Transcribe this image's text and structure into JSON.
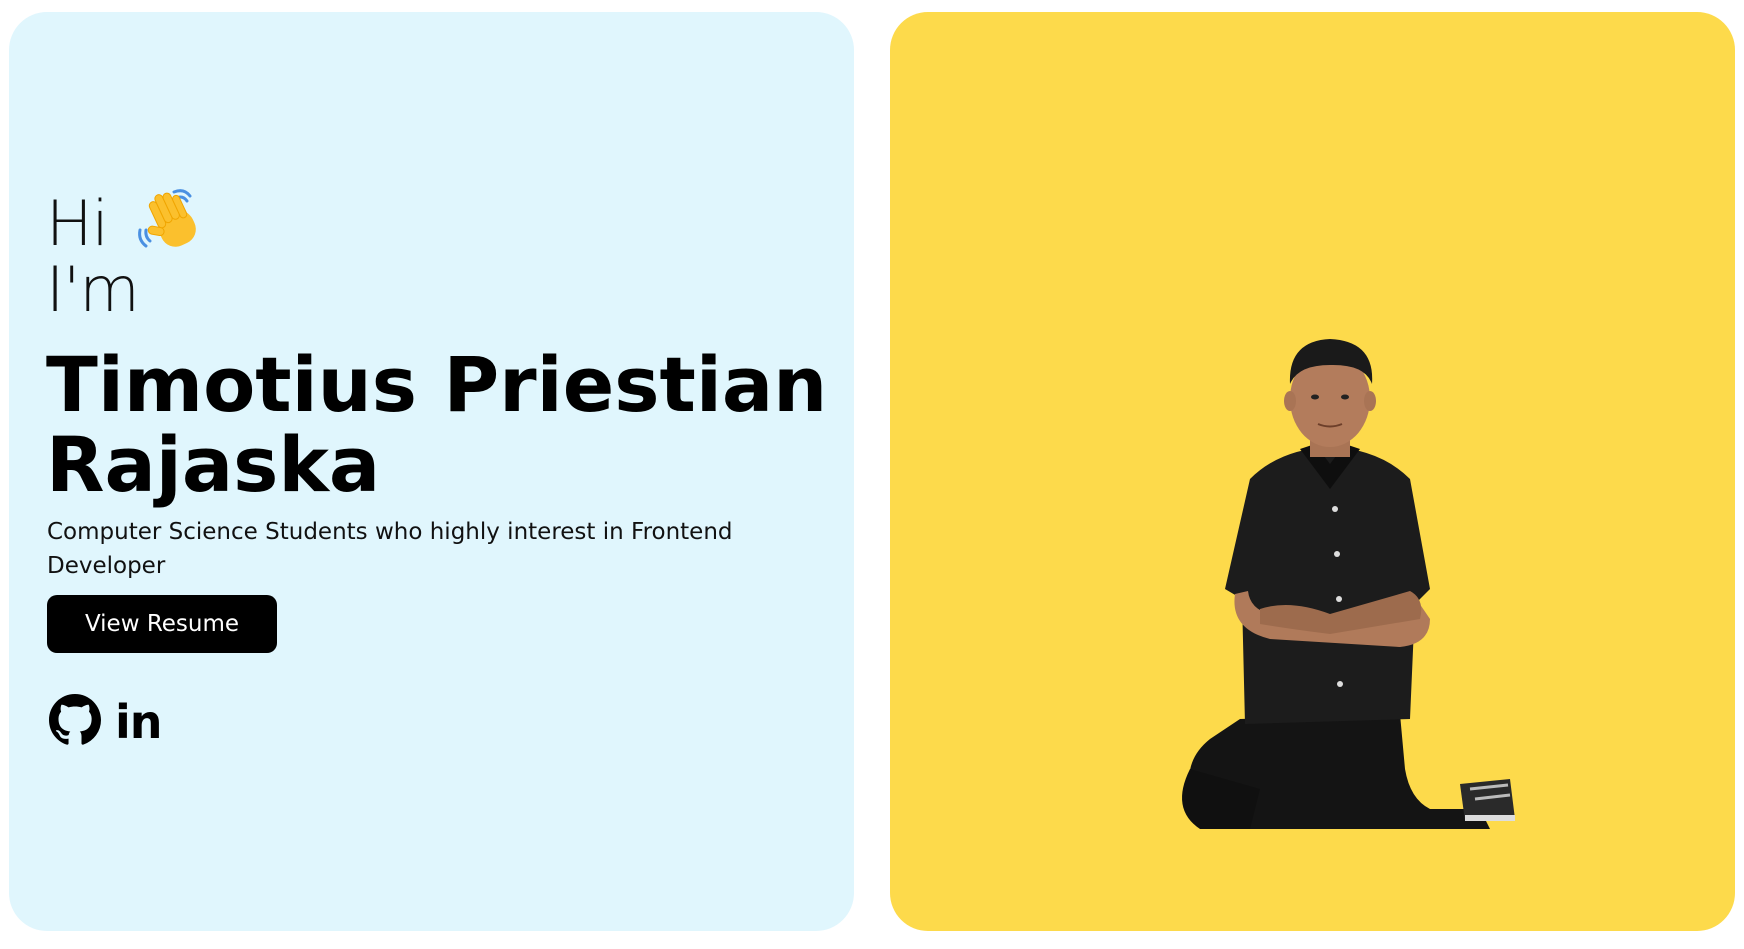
{
  "hero": {
    "greeting_hi": "Hi",
    "greeting_im": "I'm",
    "name_line1": "Timotius Priestian",
    "name_line2": "Rajaska",
    "subtitle": "Computer Science Students who highly interest in Frontend Developer",
    "resume_button": "View Resume",
    "wave_icon": "waving-hand-icon",
    "linkedin_label": "in"
  },
  "socials": [
    "github-icon",
    "linkedin-icon"
  ],
  "colors": {
    "left_card_bg": "#e0f6fd",
    "right_card_bg": "#fdda4b",
    "button_bg": "#000000",
    "button_text": "#ffffff"
  }
}
